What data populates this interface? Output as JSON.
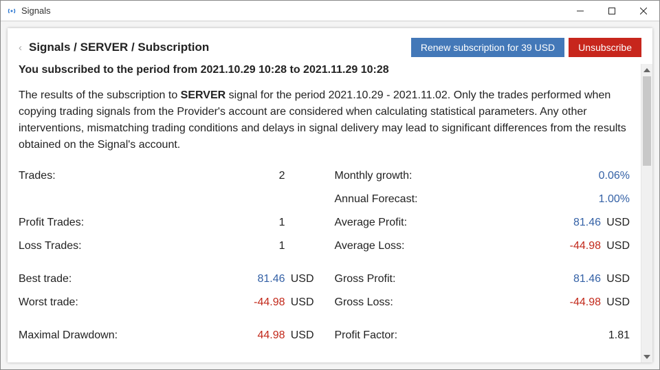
{
  "window": {
    "title": "Signals"
  },
  "header": {
    "breadcrumb": "Signals / SERVER / Subscription",
    "renew_label": "Renew subscription for 39 USD",
    "unsubscribe_label": "Unsubscribe"
  },
  "subscribed_line": "You subscribed to the period from 2021.10.29 10:28 to 2021.11.29 10:28",
  "description": {
    "prefix": "The results of the subscription to ",
    "server": "SERVER",
    "suffix": " signal for the period 2021.10.29 - 2021.11.02. Only the trades performed when copying trading signals from the Provider's account are considered when calculating statistical parameters. Any other interventions, mismatching trading conditions and delays in signal delivery may lead to significant differences from the results obtained on the Signal's account."
  },
  "stats": {
    "left": {
      "trades_label": "Trades:",
      "trades_value": "2",
      "profit_trades_label": "Profit Trades:",
      "profit_trades_value": "1",
      "loss_trades_label": "Loss Trades:",
      "loss_trades_value": "1",
      "best_trade_label": "Best trade:",
      "best_trade_value": "81.46",
      "best_trade_unit": "USD",
      "worst_trade_label": "Worst trade:",
      "worst_trade_value": "-44.98",
      "worst_trade_unit": "USD",
      "max_drawdown_label": "Maximal Drawdown:",
      "max_drawdown_value": "44.98",
      "max_drawdown_unit": "USD"
    },
    "right": {
      "monthly_growth_label": "Monthly growth:",
      "monthly_growth_value": "0.06%",
      "annual_forecast_label": "Annual Forecast:",
      "annual_forecast_value": "1.00%",
      "avg_profit_label": "Average Profit:",
      "avg_profit_value": "81.46",
      "avg_profit_unit": "USD",
      "avg_loss_label": "Average Loss:",
      "avg_loss_value": "-44.98",
      "avg_loss_unit": "USD",
      "gross_profit_label": "Gross Profit:",
      "gross_profit_value": "81.46",
      "gross_profit_unit": "USD",
      "gross_loss_label": "Gross Loss:",
      "gross_loss_value": "-44.98",
      "gross_loss_unit": "USD",
      "profit_factor_label": "Profit Factor:",
      "profit_factor_value": "1.81"
    }
  }
}
